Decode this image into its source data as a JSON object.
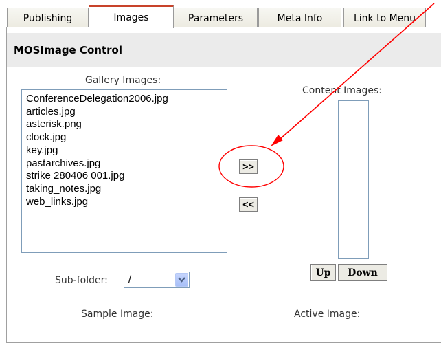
{
  "tabs": [
    {
      "label": "Publishing",
      "active": false
    },
    {
      "label": "Images",
      "active": true
    },
    {
      "label": "Parameters",
      "active": false
    },
    {
      "label": "Meta Info",
      "active": false
    },
    {
      "label": "Link to Menu",
      "active": false
    }
  ],
  "panel": {
    "title": "MOSImage Control"
  },
  "gallery": {
    "label": "Gallery Images:",
    "items": [
      "ConferenceDelegation2006.jpg",
      "articles.jpg",
      "asterisk.png",
      "clock.jpg",
      "key.jpg",
      "pastarchives.jpg",
      "strike 280406 001.jpg",
      "taking_notes.jpg",
      "web_links.jpg"
    ]
  },
  "content": {
    "label": "Content Images:",
    "items": []
  },
  "buttons": {
    "add_label": ">>",
    "remove_label": "<<",
    "up_label": "Up",
    "down_label": "Down"
  },
  "subfolder": {
    "label": "Sub-folder:",
    "value": "/"
  },
  "sample_label": "Sample Image:",
  "active_label": "Active Image:",
  "annotation": {
    "color": "#ff0000",
    "shapes": [
      "arrow",
      "circle"
    ]
  },
  "colors": {
    "active_tab_accent": "#c8432a",
    "header_bg": "#ebebeb",
    "list_border": "#7f9db9"
  }
}
